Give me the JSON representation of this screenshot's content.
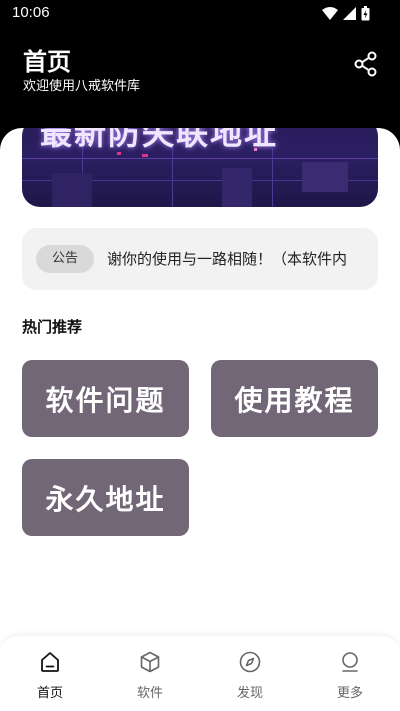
{
  "status_bar": {
    "time": "10:06"
  },
  "header": {
    "title": "首页",
    "subtitle": "欢迎使用八戒软件库"
  },
  "banner": {
    "text": "最新防失联地址"
  },
  "notice": {
    "badge": "公告",
    "text": "谢你的使用与一路相随！（本软件内"
  },
  "hot": {
    "title": "热门推荐",
    "tiles": [
      {
        "label": "软件问题"
      },
      {
        "label": "使用教程"
      },
      {
        "label": "永久地址"
      }
    ]
  },
  "nav": {
    "items": [
      {
        "label": "首页",
        "icon": "home-icon"
      },
      {
        "label": "软件",
        "icon": "box-icon"
      },
      {
        "label": "发现",
        "icon": "compass-icon"
      },
      {
        "label": "更多",
        "icon": "profile-icon"
      }
    ],
    "active": 0
  },
  "colors": {
    "tile": "#716777",
    "header_bg": "#000000",
    "banner": "#2b1f63"
  }
}
